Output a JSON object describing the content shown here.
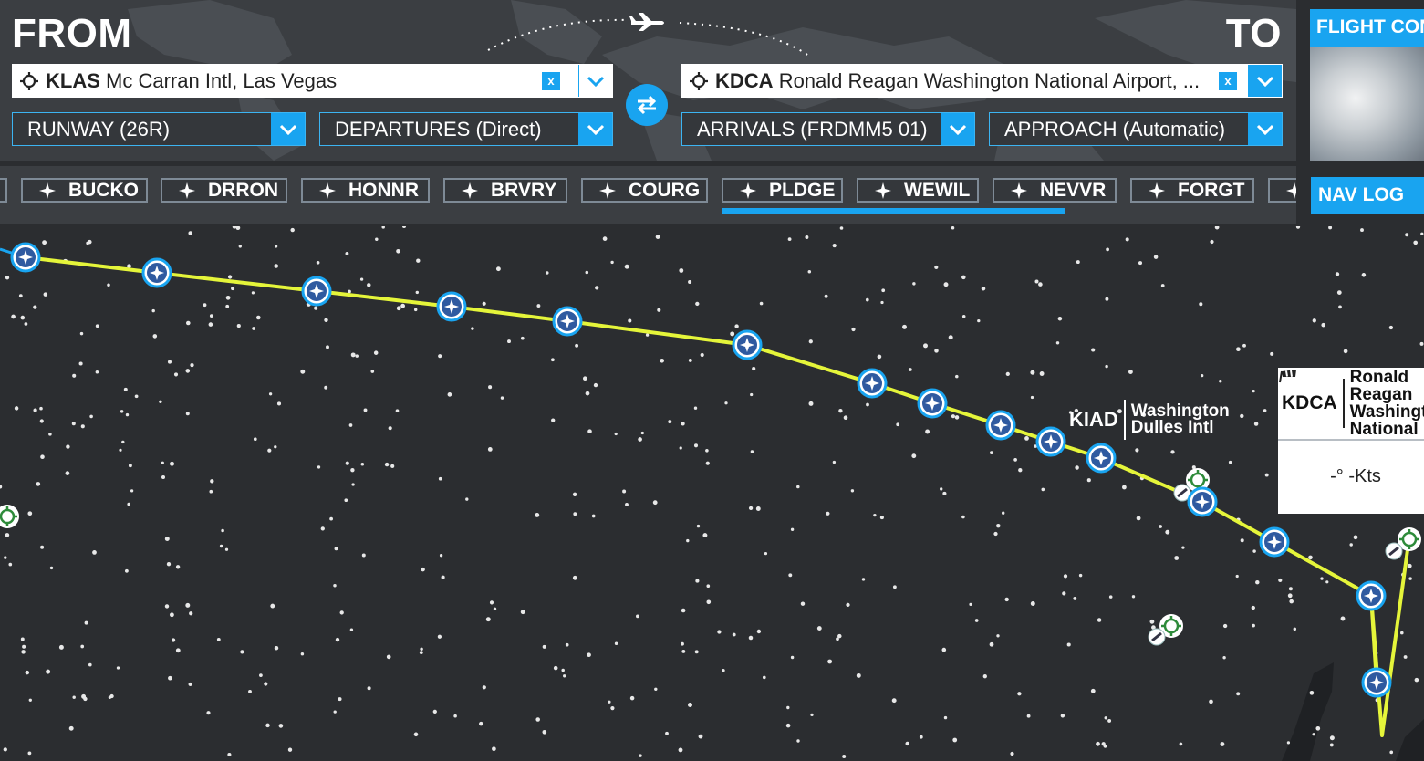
{
  "header": {
    "from_label": "FROM",
    "to_label": "TO",
    "from_airport": {
      "code": "KLAS",
      "name": "Mc Carran Intl, Las Vegas",
      "clear": "x"
    },
    "to_airport": {
      "code": "KDCA",
      "name": "Ronald Reagan Washington National Airport, ...",
      "clear": "x"
    },
    "runway": "RUNWAY (26R)",
    "departures": "DEPARTURES (Direct)",
    "arrivals": "ARRIVALS (FRDMM5 01)",
    "approach": "APPROACH (Automatic)"
  },
  "side_panel": {
    "flight_conditions": "FLIGHT CONDITIONS",
    "nav_log": "NAV LOG"
  },
  "waypoints": [
    "BUCKO",
    "DRRON",
    "HONNR",
    "BRVRY",
    "COURG",
    "PLDGE",
    "WEWIL",
    "NEVVR",
    "FORGT"
  ],
  "map": {
    "kiad": {
      "code": "KIAD",
      "name": "Washington Dulles Intl"
    },
    "kdca": {
      "code": "KDCA",
      "name": "Ronald Reagan Washington National"
    },
    "wind": "-° -Kts"
  },
  "colors": {
    "accent": "#19a4f0",
    "route": "#e5f53a",
    "panel": "#3b3e42",
    "map_bg": "#2b2d30"
  }
}
